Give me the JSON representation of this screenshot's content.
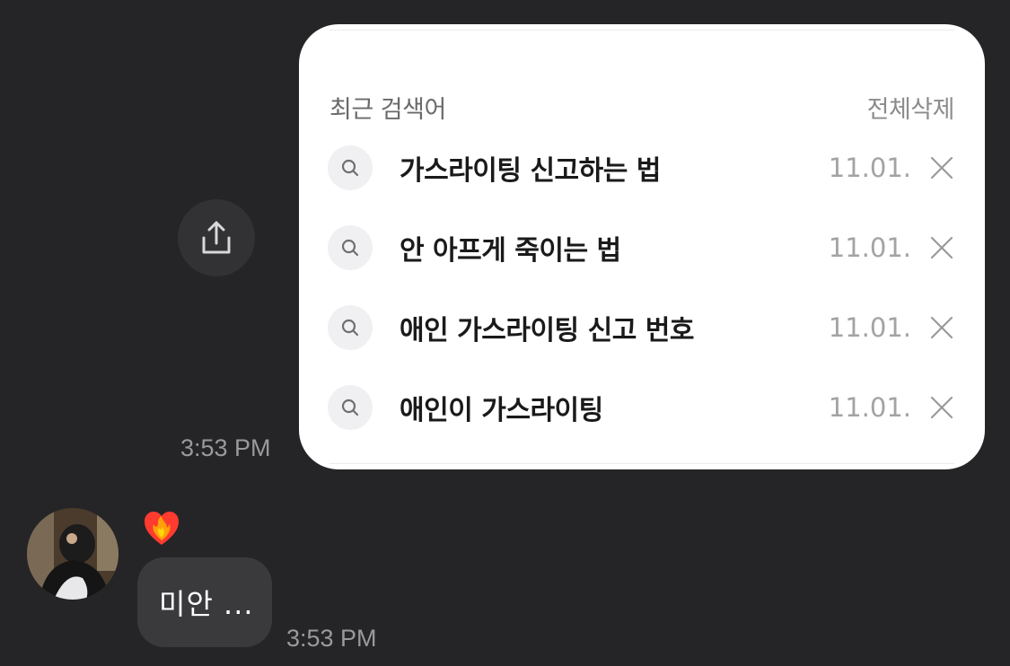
{
  "share_button": {
    "icon": "share-icon"
  },
  "recent_search": {
    "title": "최근 검색어",
    "clear_all": "전체삭제",
    "items": [
      {
        "query": "가스라이팅 신고하는 법",
        "date": "11.01."
      },
      {
        "query": "안 아프게 죽이는 법",
        "date": "11.01."
      },
      {
        "query": "애인 가스라이팅 신고 번호",
        "date": "11.01."
      },
      {
        "query": "애인이 가스라이팅",
        "date": "11.01."
      }
    ]
  },
  "sent_time": "3:53 PM",
  "incoming": {
    "reaction": "heart-on-fire-emoji",
    "text": "미안 ...",
    "time": "3:53 PM"
  },
  "colors": {
    "background": "#252527",
    "card": "#ffffff",
    "bubble": "#3a3a3c"
  }
}
